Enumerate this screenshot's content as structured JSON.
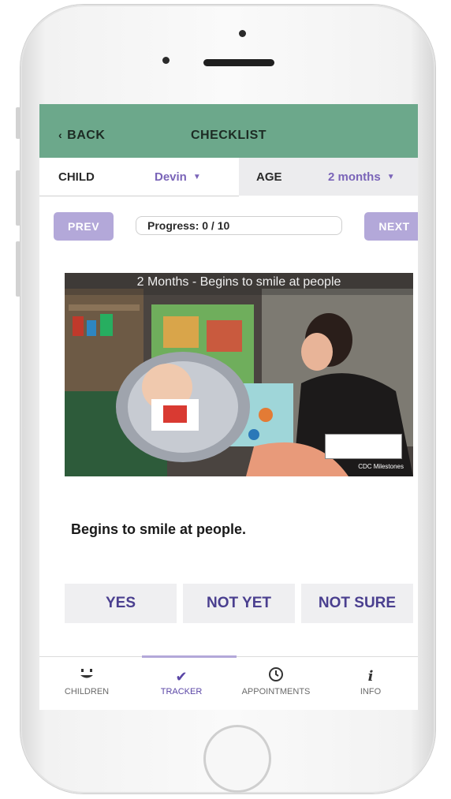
{
  "header": {
    "back_label": "BACK",
    "title": "CHECKLIST"
  },
  "selectors": {
    "child_label": "CHILD",
    "child_value": "Devin",
    "age_label": "AGE",
    "age_value": "2 months"
  },
  "progress": {
    "prev_label": "PREV",
    "text": "Progress: 0 / 10",
    "next_label": "NEXT",
    "fraction": 0
  },
  "milestone": {
    "photo_caption": "2 Months - Begins to smile at people",
    "badge_text": "CDC Milestones",
    "question": "Begins to smile at people."
  },
  "answers": {
    "yes": "YES",
    "not_yet": "NOT YET",
    "not_sure": "NOT SURE"
  },
  "tabs": [
    {
      "label": "CHILDREN",
      "icon": "smiley-face-icon"
    },
    {
      "label": "TRACKER",
      "icon": "checkmark-icon"
    },
    {
      "label": "APPOINTMENTS",
      "icon": "clock-icon"
    },
    {
      "label": "INFO",
      "icon": "info-icon"
    }
  ],
  "colors": {
    "header_bg": "#6ca88b",
    "accent_purple": "#7a64b8",
    "button_lavender": "#b3a8d9",
    "answer_text": "#4a3f8f"
  }
}
